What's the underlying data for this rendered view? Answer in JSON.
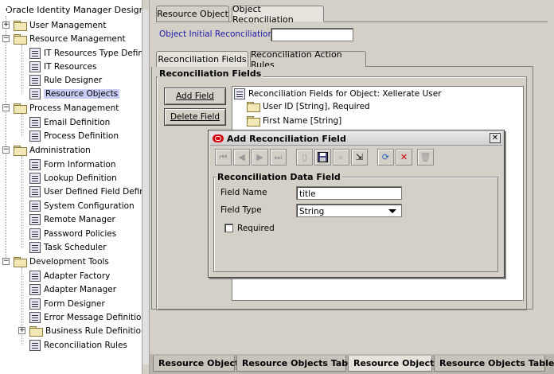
{
  "app": {
    "title": "Oracle Identity Manager Design Conso"
  },
  "tree": {
    "groups": [
      {
        "label": "User Management",
        "expanded": false
      },
      {
        "label": "Resource Management",
        "expanded": true,
        "items": [
          "IT Resources Type Definition",
          "IT Resources",
          "Rule Designer",
          "Resource Objects"
        ]
      },
      {
        "label": "Process Management",
        "expanded": true,
        "items": [
          "Email Definition",
          "Process Definition"
        ]
      },
      {
        "label": "Administration",
        "expanded": true,
        "items": [
          "Form Information",
          "Lookup Definition",
          "User Defined Field Definition",
          "System Configuration",
          "Remote Manager",
          "Password Policies",
          "Task Scheduler"
        ]
      },
      {
        "label": "Development Tools",
        "expanded": true,
        "items": [
          "Adapter Factory",
          "Adapter Manager",
          "Form Designer",
          "Error Message Definition",
          "Business Rule Definition",
          "Reconciliation Rules"
        ]
      }
    ],
    "selected": "Resource Objects"
  },
  "main": {
    "tabs": [
      "Resource Object",
      "Object Reconciliation"
    ],
    "active_tab": "Object Reconciliation",
    "initial_recon_date_label": "Object Initial Reconciliation Date",
    "initial_recon_date_value": "",
    "subtabs": [
      "Reconciliation Fields",
      "Reconciliation Action Rules"
    ],
    "group_title": "Reconciliation Fields",
    "add_field_label": "Add Field",
    "delete_field_label": "Delete Field",
    "fields_root": "Reconciliation Fields for Object: Xellerate User",
    "fields": [
      "User ID [String], Required",
      "First Name [String]"
    ]
  },
  "dialog": {
    "title": "Add Reconciliation Field",
    "group_title": "Reconciliation Data Field",
    "field_name_label": "Field Name",
    "field_name_value": "title",
    "field_type_label": "Field Type",
    "field_type_value": "String",
    "required_label": "Required",
    "required_checked": false
  },
  "bottom_tabs": [
    "Resource Objects",
    "Resource Objects Table",
    "Resource Objects",
    "Resource Objects Table"
  ],
  "bottom_active": 2
}
